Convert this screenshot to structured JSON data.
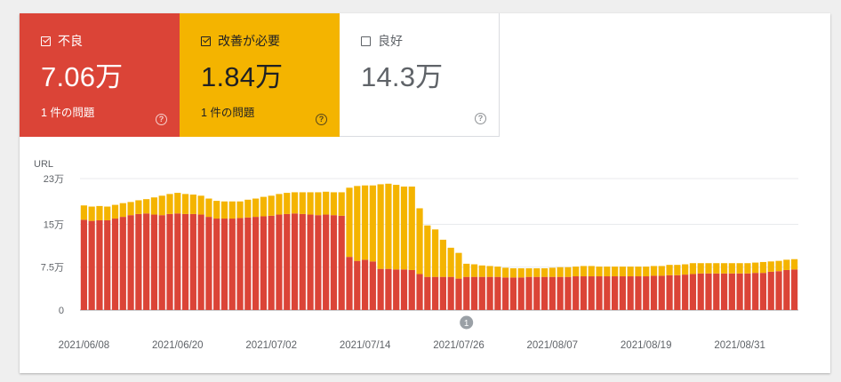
{
  "tiles": [
    {
      "label": "不良",
      "value": "7.06万",
      "issues": "1 件の問題",
      "checked": true,
      "color": "#db4437"
    },
    {
      "label": "改善が必要",
      "value": "1.84万",
      "issues": "1 件の問題",
      "checked": true,
      "color": "#f4b400"
    },
    {
      "label": "良好",
      "value": "14.3万",
      "issues": "",
      "checked": false,
      "color": "#ffffff"
    }
  ],
  "help_icon": "?",
  "chart_data": {
    "type": "bar",
    "stacked": true,
    "ylabel": "URL",
    "ylim": [
      0,
      230000
    ],
    "yticks": [
      {
        "value": 0,
        "label": "0"
      },
      {
        "value": 75000,
        "label": "7.5万"
      },
      {
        "value": 150000,
        "label": "15万"
      },
      {
        "value": 230000,
        "label": "23万"
      }
    ],
    "xticks": [
      {
        "index": 0,
        "label": "2021/06/08"
      },
      {
        "index": 12,
        "label": "2021/06/20"
      },
      {
        "index": 24,
        "label": "2021/07/02"
      },
      {
        "index": 36,
        "label": "2021/07/14"
      },
      {
        "index": 48,
        "label": "2021/07/26"
      },
      {
        "index": 60,
        "label": "2021/08/07"
      },
      {
        "index": 72,
        "label": "2021/08/19"
      },
      {
        "index": 84,
        "label": "2021/08/31"
      }
    ],
    "annotations": [
      {
        "index": 49,
        "label": "1"
      }
    ],
    "grid": true,
    "colors": {
      "poor": "#db4437",
      "needs_improvement": "#f4b400"
    },
    "series": [
      {
        "name": "不良",
        "values": [
          158000,
          156000,
          157000,
          157000,
          160000,
          163000,
          166000,
          168000,
          169000,
          167000,
          166000,
          168000,
          169000,
          168000,
          168000,
          167000,
          163000,
          160000,
          160000,
          160000,
          161000,
          162000,
          163000,
          164000,
          165000,
          167000,
          168000,
          169000,
          168000,
          167000,
          166000,
          167000,
          166000,
          165000,
          93000,
          86000,
          88000,
          85000,
          72000,
          72000,
          71000,
          71000,
          70000,
          63000,
          58000,
          58000,
          58000,
          58000,
          55000,
          58000,
          58000,
          58000,
          58000,
          58000,
          57000,
          57000,
          57000,
          58000,
          58000,
          58000,
          58000,
          58000,
          58000,
          59000,
          59000,
          59000,
          59000,
          59000,
          59000,
          59000,
          59000,
          59000,
          59000,
          60000,
          60000,
          61000,
          61000,
          62000,
          63000,
          64000,
          64000,
          64000,
          64000,
          64000,
          64000,
          64000,
          65000,
          65000,
          67000,
          68000,
          70000,
          71000
        ]
      },
      {
        "name": "改善が必要",
        "values": [
          25000,
          25000,
          25000,
          24000,
          24000,
          24000,
          23000,
          24000,
          25000,
          30000,
          34000,
          35000,
          36000,
          35000,
          34000,
          33000,
          32000,
          31000,
          30000,
          30000,
          29000,
          31000,
          32000,
          34000,
          35000,
          36000,
          37000,
          37000,
          38000,
          39000,
          40000,
          40000,
          40000,
          41000,
          121000,
          131000,
          130000,
          133000,
          148000,
          149000,
          148000,
          145000,
          146000,
          115000,
          90000,
          83000,
          65000,
          51000,
          45000,
          23000,
          22000,
          20000,
          19000,
          18000,
          17000,
          16000,
          16000,
          15000,
          15000,
          15000,
          16000,
          17000,
          17000,
          17000,
          18000,
          18000,
          17000,
          17000,
          17000,
          17000,
          17000,
          17000,
          17000,
          17000,
          17000,
          18000,
          18000,
          18000,
          19000,
          18000,
          18000,
          18000,
          18000,
          18000,
          18000,
          18000,
          18000,
          19000,
          18000,
          18000,
          18000,
          18000
        ]
      }
    ]
  }
}
